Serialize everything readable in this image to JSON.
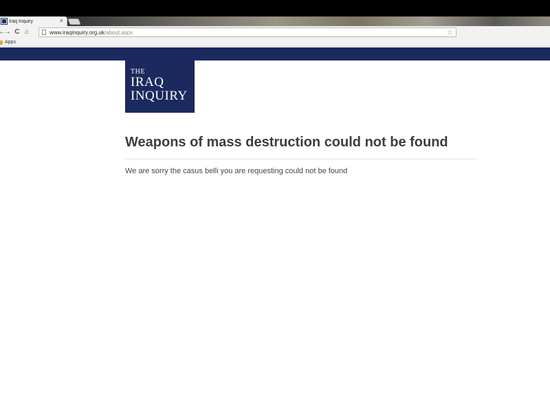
{
  "browser": {
    "tab_title": "Iraq Inquiry",
    "tab_close": "×",
    "url_host": "www.iraqinquiry.org.uk",
    "url_path": "/about.aspx",
    "back_glyph": "←",
    "forward_glyph": "→",
    "reload_glyph": "C",
    "home_glyph": "⌂",
    "star_glyph": "☆",
    "bookmarks": {
      "apps_label": "Apps"
    }
  },
  "site": {
    "brand_color": "#1b2a5e",
    "logo": {
      "line1": "THE",
      "line2": "IRAQ",
      "line3": "INQUIRY"
    }
  },
  "main": {
    "heading": "Weapons of mass destruction could not be found",
    "message": "We are sorry the casus belli you are requesting could not be found"
  }
}
